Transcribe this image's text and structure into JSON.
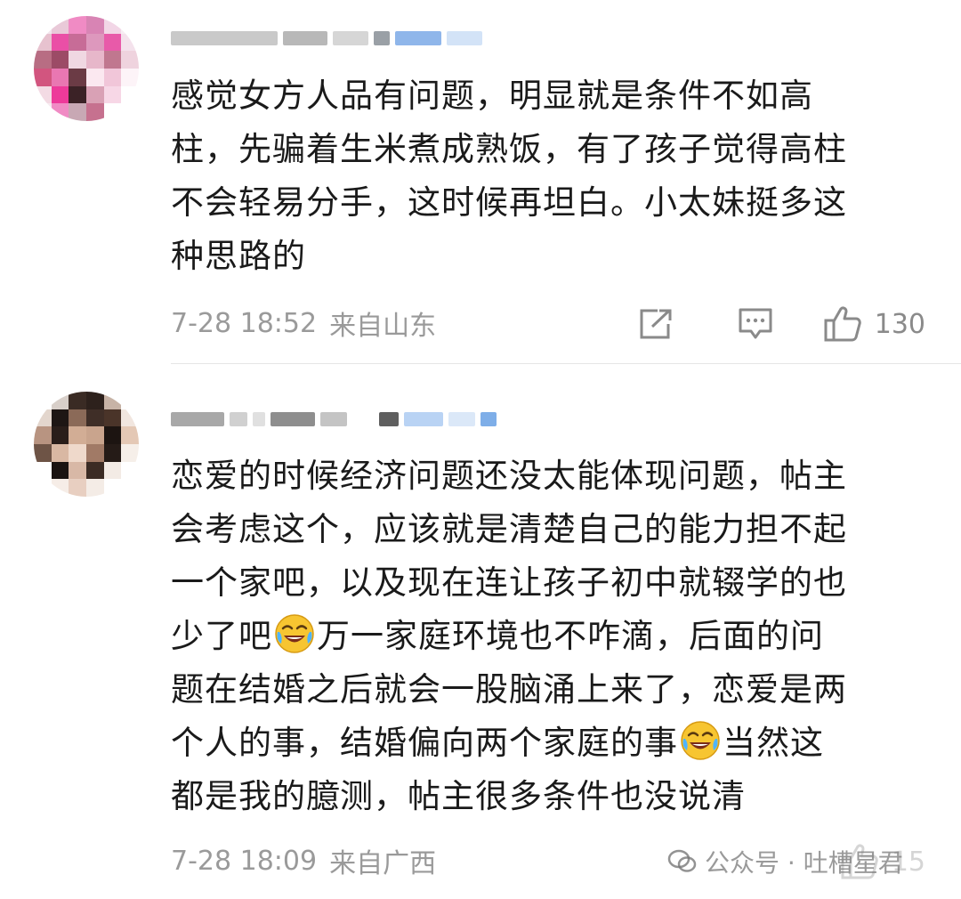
{
  "comments": [
    {
      "text_lines": [
        "感觉女方人品有问题，明显就是条件不如高",
        "柱，先骗着生米煮成熟饭，有了孩子觉得高柱",
        "不会轻易分手，这时候再坦白。小太妹挺多这",
        "种思路的"
      ],
      "time": "7-28 18:52",
      "location": "来自山东",
      "like_count": "130"
    },
    {
      "text_lines": [
        "恋爱的时候经济问题还没太能体现问题，帖主",
        "会考虑这个，应该就是清楚自己的能力担不起",
        "一个家吧，以及现在连让孩子初中就辍学的也"
      ],
      "line4_before": "少了吧",
      "line4_after": "万一家庭环境也不咋滴，后面的问",
      "line5": "题在结婚之后就会一股脑涌上来了，恋爱是两",
      "line6_before": "个人的事，结婚偏向两个家庭的事",
      "line6_after": "当然这",
      "line7": "都是我的臆测，帖主很多条件也没说清",
      "time": "7-28 18:09",
      "location": "来自广西",
      "like_count": "15"
    }
  ],
  "icons": {
    "share": "share-icon",
    "reply": "comment-icon",
    "like": "thumbs-up-icon",
    "emoji": "crying-laughing-emoji"
  },
  "watermark": {
    "text": "公众号 · 吐槽星君"
  },
  "colors": {
    "text": "#1a1a1a",
    "meta": "#9a9a9a",
    "divider": "#e6e6e6"
  }
}
